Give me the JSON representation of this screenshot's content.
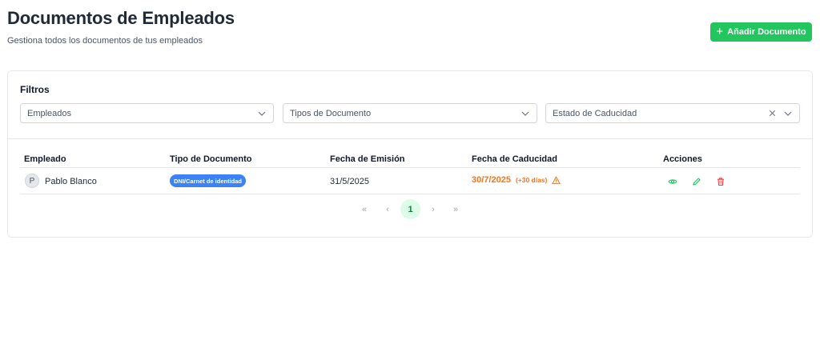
{
  "header": {
    "title": "Documentos de Empleados",
    "subtitle": "Gestiona todos los documentos de tus empleados",
    "add_button_label": "Añadir Documento"
  },
  "filters": {
    "title": "Filtros",
    "employees_value": "Empleados",
    "doc_types_value": "Tipos de Documento",
    "expiry_status_value": "Estado de Caducidad"
  },
  "table": {
    "columns": [
      "Empleado",
      "Tipo de Documento",
      "Fecha de Emisión",
      "Fecha de Caducidad",
      "Acciones"
    ],
    "rows": [
      {
        "avatar_initial": "P",
        "employee": "Pablo Blanco",
        "doc_type": "DNI/Carnet de identidad",
        "issue_date": "31/5/2025",
        "expiry_date": "30/7/2025",
        "expiry_note": "(+30 días)"
      }
    ]
  },
  "pagination": {
    "first": "«",
    "prev": "‹",
    "current": "1",
    "next": "›",
    "last": "»"
  },
  "colors": {
    "accent_green": "#22c55e",
    "badge_blue": "#3b82f6",
    "warning_orange": "#f97316",
    "danger_red": "#ef4444"
  },
  "icons": {
    "plus": "plus-icon",
    "chevron": "chevron-down-icon",
    "clear": "close-icon",
    "warning": "warning-icon",
    "view": "eye-icon",
    "edit": "pencil-icon",
    "delete": "trash-icon"
  }
}
